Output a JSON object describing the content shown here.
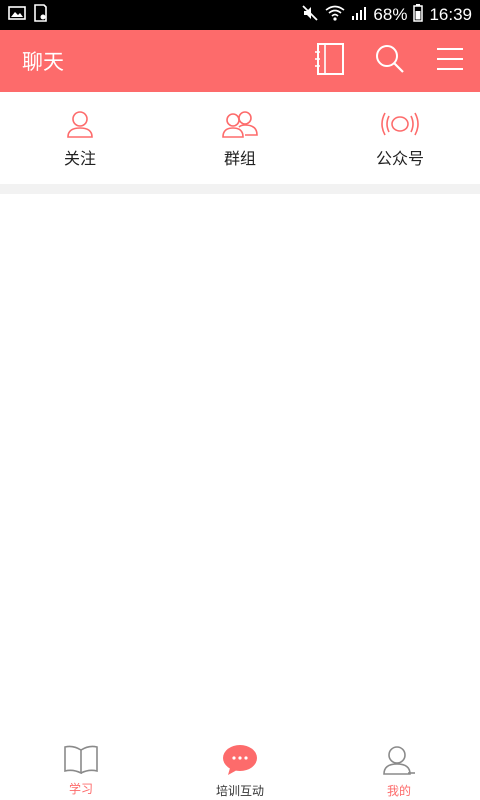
{
  "status_bar": {
    "battery": "68%",
    "time": "16:39",
    "icons": [
      "image-icon",
      "sd-card-icon",
      "mute-icon",
      "wifi-icon",
      "signal-icon",
      "battery-icon"
    ]
  },
  "header": {
    "title": "聊天",
    "actions": [
      "contacts-book-icon",
      "search-icon",
      "menu-icon"
    ]
  },
  "quick_tabs": [
    {
      "label": "关注",
      "icon": "person-icon"
    },
    {
      "label": "群组",
      "icon": "group-icon"
    },
    {
      "label": "公众号",
      "icon": "broadcast-icon"
    }
  ],
  "bottom_nav": [
    {
      "label": "学习",
      "icon": "book-icon"
    },
    {
      "label": "培训互动",
      "icon": "chat-bubble-icon",
      "active": true
    },
    {
      "label": "我的",
      "icon": "profile-icon"
    }
  ],
  "colors": {
    "accent": "#fd6b6b",
    "status_bar": "#000000",
    "divider": "#f2f2f2"
  }
}
